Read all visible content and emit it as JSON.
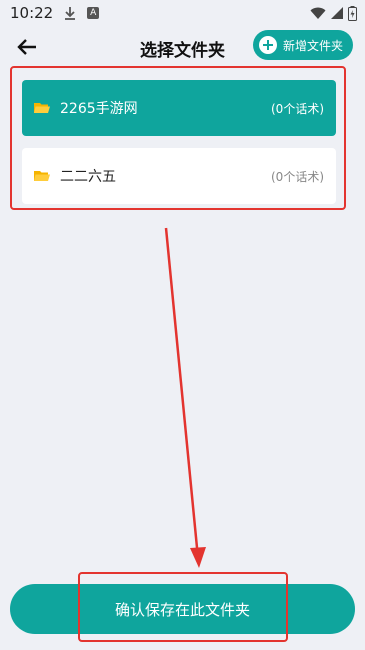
{
  "status_bar": {
    "time": "10:22",
    "a_badge": "A"
  },
  "header": {
    "title": "选择文件夹",
    "new_folder_label": "新增文件夹"
  },
  "folders": [
    {
      "name": "2265手游网",
      "count": "(0个话术)",
      "selected": true
    },
    {
      "name": "二二六五",
      "count": "(0个话术)",
      "selected": false
    }
  ],
  "confirm_button_label": "确认保存在此文件夹",
  "colors": {
    "accent": "#0fa59d",
    "annotation_red": "#e3342f",
    "folder_yellow": "#f5b400"
  }
}
